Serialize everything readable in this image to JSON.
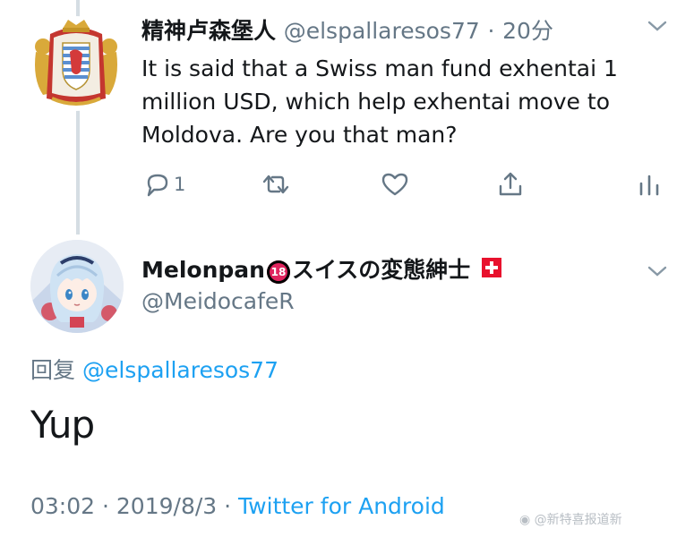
{
  "parent_tweet": {
    "display_name": "精神卢森堡人",
    "handle": "@elspallaresos77",
    "separator": "·",
    "time": "20分",
    "text": "It is said that a Swiss man fund exhentai 1 million USD, which help exhentai move to Moldova. Are you that man?",
    "reply_count": "1"
  },
  "main_tweet": {
    "display_name": "Melonpan",
    "badge_text": "18",
    "display_name_suffix": "スイスの変態紳士",
    "handle": "@MeidocafeR",
    "reply_label": "回复",
    "reply_to": "@elspallaresos77",
    "text": "Yup",
    "meta": {
      "time": "03:02",
      "sep1": "·",
      "date": "2019/8/3",
      "sep2": "·",
      "client": "Twitter for Android"
    }
  },
  "watermark": "@新特喜报道新",
  "colors": {
    "link": "#1da1f2",
    "muted": "#657786",
    "thread_line": "#d5dde3",
    "swiss_red": "#e8112d"
  }
}
